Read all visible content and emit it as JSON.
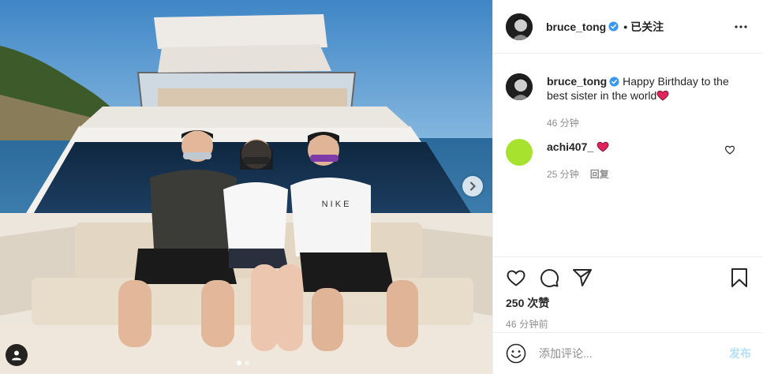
{
  "post": {
    "author": "bruce_tong",
    "follow_separator": "•",
    "follow_label": "已关注",
    "caption": "Happy Birthday to the best sister in the world",
    "caption_time": "46 分钟",
    "likes": "250 次赞",
    "posted_ago": "46 分钟前",
    "shirt_text": "N I K E"
  },
  "comments": [
    {
      "username": "achi407_",
      "time": "25 分钟",
      "reply_label": "回复",
      "avatar_color": "#a6e22e"
    }
  ],
  "add_comment": {
    "placeholder": "添加评论...",
    "post_label": "发布"
  },
  "carousel": {
    "total": 2,
    "current": 1
  },
  "colors": {
    "verified": "#3897f0",
    "heart": "#ed4956",
    "post_button_disabled": "#b2dffc"
  }
}
